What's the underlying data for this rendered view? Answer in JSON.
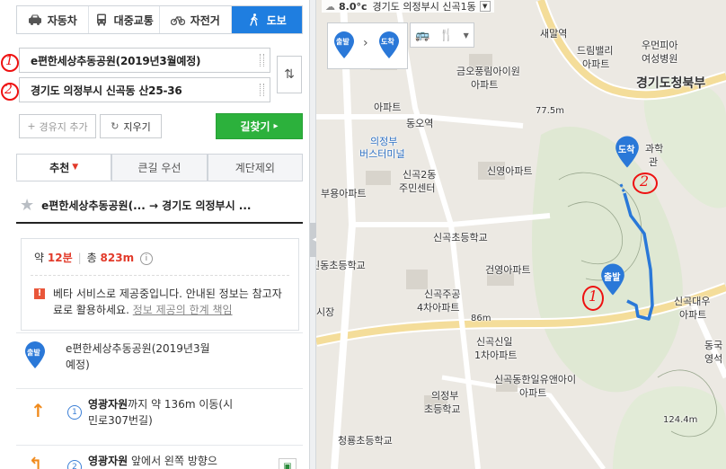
{
  "modes": [
    {
      "label": "자동차",
      "icon": "car-icon"
    },
    {
      "label": "대중교통",
      "icon": "bus-icon"
    },
    {
      "label": "자전거",
      "icon": "bicycle-icon"
    },
    {
      "label": "도보",
      "icon": "walk-icon",
      "active": true
    }
  ],
  "origin": {
    "value": "e편한세상추동공원(2019년3월예정)",
    "annotation": "1"
  },
  "destination": {
    "value": "경기도 의정부시 신곡동 산25-36",
    "annotation": "2"
  },
  "buttons": {
    "add_waypoint": "경유지 추가",
    "clear": "지우기",
    "search": "길찾기"
  },
  "tabs": [
    {
      "label": "추천",
      "active": true
    },
    {
      "label": "큰길 우선"
    },
    {
      "label": "계단제외"
    }
  ],
  "route_title": "e편한세상추동공원(... → 경기도 의정부시 ...",
  "summary": {
    "prefix": "약",
    "time": "12분",
    "total_label": "총",
    "distance": "823m",
    "notice": "베타 서비스로 제공중입니다. 안내된 정보는 참고자료로 활용하세요.",
    "notice_link": "정보 제공의 한계 책임"
  },
  "steps": [
    {
      "badge": "출발",
      "text": "e편한세상추동공원(2019년3월",
      "text2": "예정)"
    },
    {
      "num": "1",
      "bold": "영광자원",
      "text": "까지 약 136m 이동(시",
      "text2": "민로307번길)"
    },
    {
      "num": "2",
      "bold": "영광자원",
      "text": " 앞에서 왼쪽 방향으"
    }
  ],
  "map": {
    "weather_temp": "8.0°c",
    "weather_location": "경기도 의정부시 신곡1동",
    "start_badge": "출발",
    "end_badge": "도착",
    "labels": {
      "l1": "새말역",
      "l2": "드림밸리",
      "l3": "아파트",
      "l4": "우먼피아",
      "l5": "여성병원",
      "l6": "경기도청북부",
      "l7": "금오풍림아이원",
      "l8": "아파트",
      "l9": "77.5m",
      "l10": "동오역",
      "l11": "의정부",
      "l12": "버스터미널",
      "l13": "신곡2동",
      "l14": "주민센터",
      "l15": "신영아파트",
      "l16": "부용아파트",
      "l17": "과학",
      "l18": "관",
      "l19": "신곡초등학교",
      "l20": "신동초등학교",
      "l21": "건영아파트",
      "l22": "신곡주공",
      "l23": "4차아파트",
      "l24": "86m",
      "l25": "신곡대우",
      "l26": "아파트",
      "l27": "신곡신일",
      "l28": "1차아파트",
      "l29": "신곡동한일유앤아이",
      "l30": "아파트",
      "l31": "의정부",
      "l32": "초등학교",
      "l33": "동국",
      "l34": "영석",
      "l35": "124.4m",
      "l36": "청룡초등학교",
      "l37": "시장",
      "l38": "아파트"
    },
    "annotation_1": "1",
    "annotation_2": "2"
  }
}
